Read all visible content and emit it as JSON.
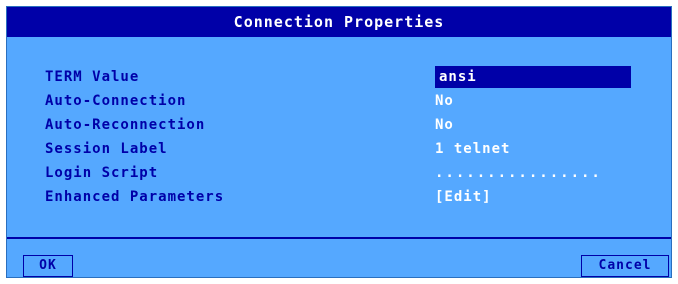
{
  "dialog": {
    "title": "Connection Properties"
  },
  "fields": [
    {
      "label": "TERM Value",
      "value": "ansi"
    },
    {
      "label": "Auto-Connection",
      "value": "No"
    },
    {
      "label": "Auto-Reconnection",
      "value": "No"
    },
    {
      "label": "Session Label",
      "value": "1 telnet"
    },
    {
      "label": "Login Script",
      "value": "................"
    },
    {
      "label": "Enhanced Parameters",
      "value": "[Edit]"
    }
  ],
  "buttons": {
    "ok_label": "OK",
    "cancel_label": "Cancel"
  },
  "colors": {
    "background": "#55a8ff",
    "titlebar": "#0000a8",
    "label_text": "#0000a8",
    "value_text": "#ffffff",
    "selection": "#0000a8"
  }
}
